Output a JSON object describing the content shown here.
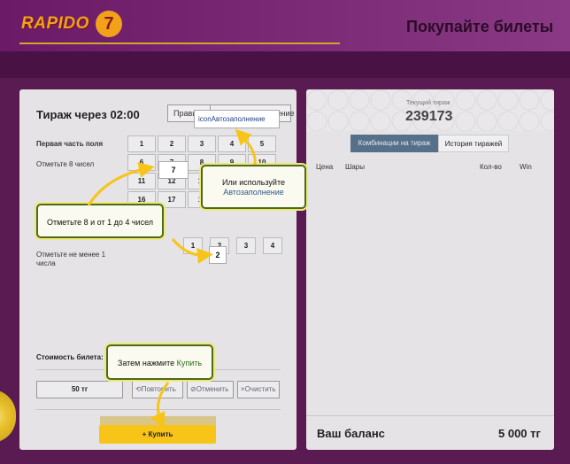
{
  "brand": {
    "logo_text": "RAPIDO",
    "logo_seven": "7"
  },
  "header": {
    "title": "Покупайте билеты"
  },
  "ticket": {
    "draw_title": "Тираж через 02:00",
    "rules_button": "Правила",
    "auto_button": "Автозаполнение",
    "auto_popup": "iconАвтозаполнение",
    "field1_label": "Первая часть поля",
    "field1_hint": "Отметьте 8 чисел",
    "grid1": [
      "1",
      "2",
      "3",
      "4",
      "5",
      "6",
      "7",
      "8",
      "9",
      "10",
      "11",
      "12",
      "13",
      "14",
      "15",
      "16",
      "17",
      "18",
      "19",
      "20"
    ],
    "field2_hint": "Отметьте не менее 1 числа",
    "grid2": [
      "1",
      "2",
      "3",
      "4"
    ],
    "cost_label": "Стоимость билета: 50 тг",
    "price": "50 тг",
    "repeat_button": "⟲Повторить",
    "cancel_button": "⊘Отменить",
    "clear_button": "×Очистить",
    "buy_button": "+  Купить"
  },
  "current_draw": {
    "label": "Текущий тираж",
    "number": "239173"
  },
  "tabs": {
    "combinations": "Комбинации на тираж",
    "history": "История тиражей"
  },
  "columns": {
    "price": "Цена",
    "balls": "Шары",
    "qty": "Кол-во",
    "win": "Win"
  },
  "balance": {
    "label": "Ваш баланс",
    "value": "5 000 тг"
  },
  "tips": {
    "auto_line1": "Или используйте",
    "auto_line2": "Автозаполнение",
    "mark": "Отметьте 8 и от 1 до 4 чисел",
    "buy_line1": "Затем нажмите ",
    "buy_line2": "Купить",
    "num7": "7",
    "num2": "2"
  },
  "colors": {
    "accent_yellow": "#f7c417",
    "tab_active": "#56708a",
    "tip_border": "#4b6a1a"
  }
}
